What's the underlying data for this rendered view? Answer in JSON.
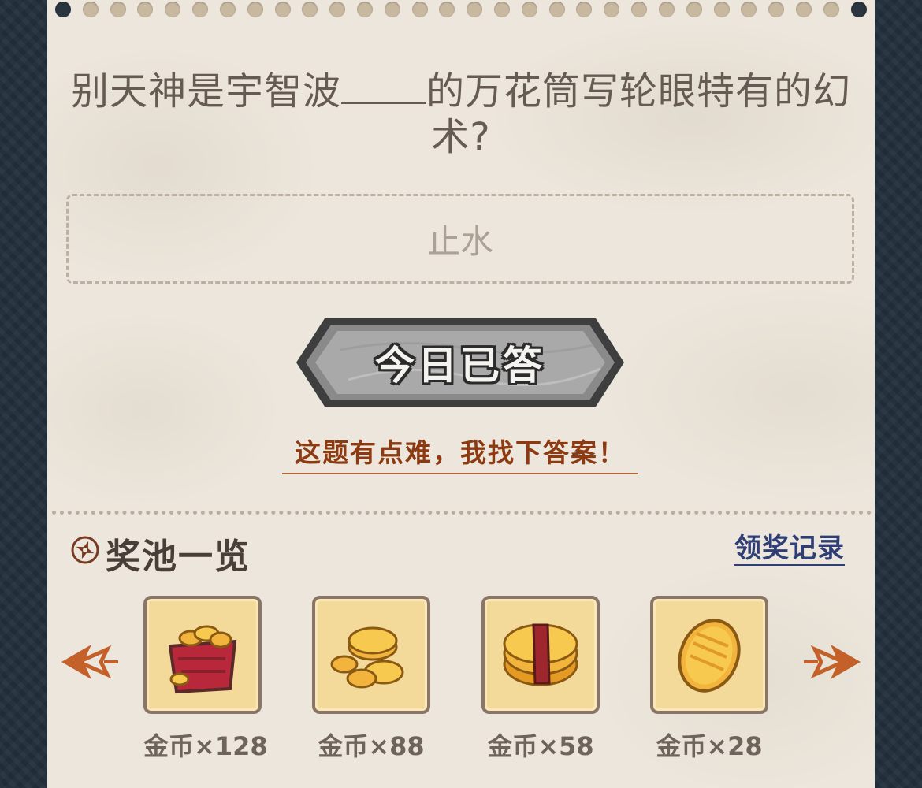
{
  "quiz": {
    "question_before": "别天神是宇智波",
    "question_after": "的万花筒写轮眼特有的幻术?",
    "answer_value": "止水",
    "answered_button_label": "今日已答",
    "hint_link_label": "这题有点难，我找下答案！"
  },
  "prize_pool": {
    "title": "奖池一览",
    "record_link_label": "领奖记录",
    "items": [
      {
        "label": "金币×128",
        "icon": "gold-coin-chest-icon"
      },
      {
        "label": "金币×88",
        "icon": "gold-coin-pile-icon"
      },
      {
        "label": "金币×58",
        "icon": "gold-coin-bundle-icon"
      },
      {
        "label": "金币×28",
        "icon": "gold-coin-icon"
      }
    ]
  },
  "colors": {
    "paper": "#ece6dc",
    "accent_brown": "#8c3a12",
    "link_blue": "#2f3f75",
    "card_gold": "#f3d99a"
  }
}
